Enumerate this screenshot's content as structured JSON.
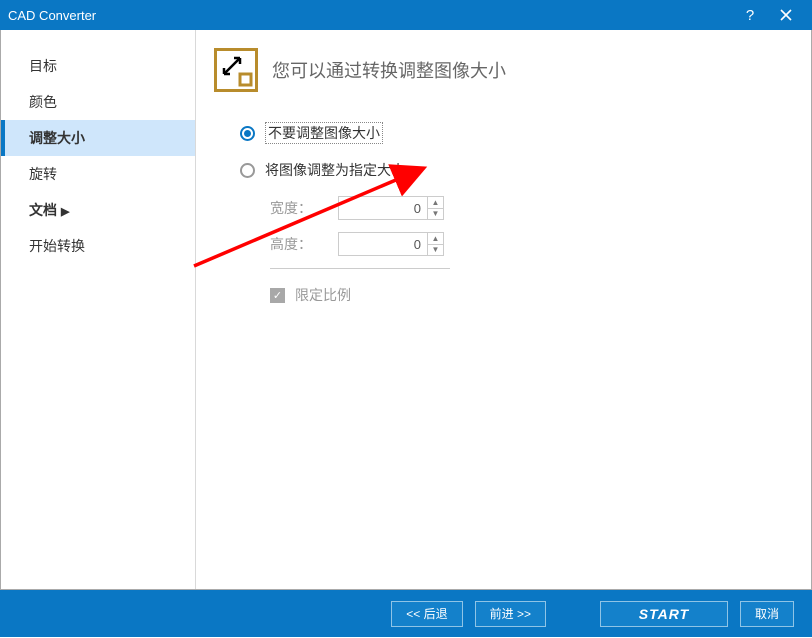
{
  "window": {
    "title": "CAD Converter"
  },
  "sidebar": {
    "items": [
      {
        "label": "目标"
      },
      {
        "label": "颜色"
      },
      {
        "label": "调整大小"
      },
      {
        "label": "旋转"
      },
      {
        "label": "文档"
      },
      {
        "label": "开始转换"
      }
    ]
  },
  "main": {
    "heading": "您可以通过转换调整图像大小",
    "radio_no_resize": "不要调整图像大小",
    "radio_resize": "将图像调整为指定大小",
    "width_label": "宽度：",
    "height_label": "高度：",
    "width_value": "0",
    "height_value": "0",
    "aspect_label": "限定比例"
  },
  "footer": {
    "back": "<< 后退",
    "forward": "前进 >>",
    "start": "START",
    "cancel": "取消"
  }
}
